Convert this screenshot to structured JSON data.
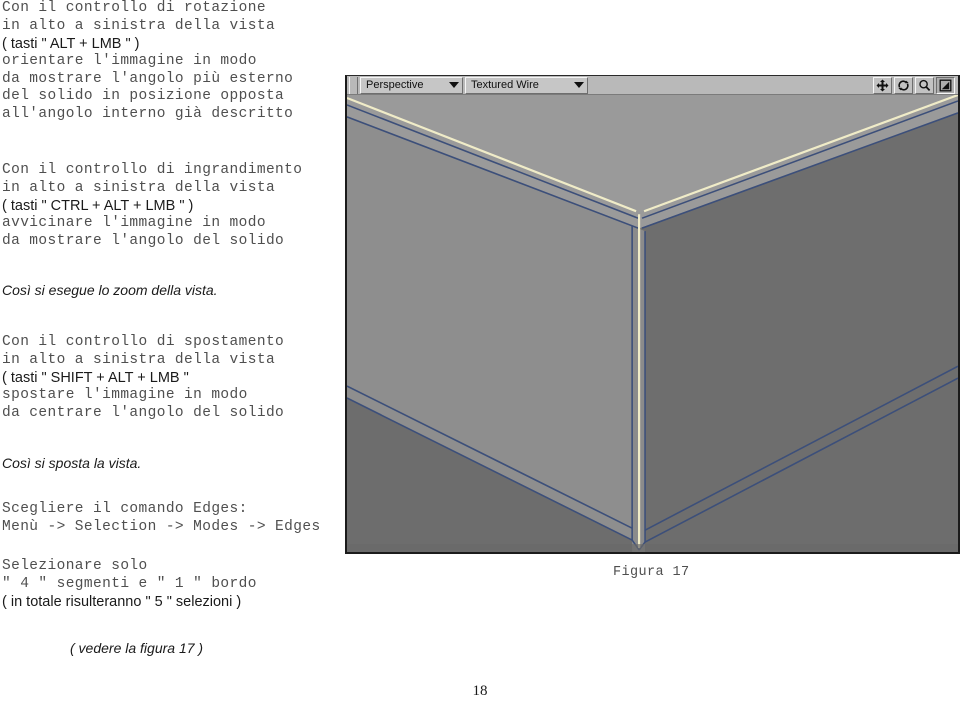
{
  "document": {
    "page_number": "18",
    "figure_caption": "Figura 17",
    "blocks": {
      "rotation": {
        "lines": [
          {
            "text": "Con il controllo di rotazione",
            "style": "mono"
          },
          {
            "text": "in alto a sinistra della vista",
            "style": "mono"
          },
          {
            "text": "( tasti \" ALT + LMB \" )",
            "style": "sans"
          },
          {
            "text": "orientare l'immagine in modo",
            "style": "mono"
          },
          {
            "text": "da mostrare l'angolo più esterno",
            "style": "mono"
          },
          {
            "text": "del solido in posizione opposta",
            "style": "mono"
          },
          {
            "text": "all'angolo interno già descritto",
            "style": "mono"
          }
        ]
      },
      "zoom": {
        "lines": [
          {
            "text": "Con il controllo di ingrandimento",
            "style": "mono"
          },
          {
            "text": "in alto a sinistra della vista",
            "style": "mono"
          },
          {
            "text": "( tasti \" CTRL + ALT + LMB \" )",
            "style": "sans"
          },
          {
            "text": "avvicinare l'immagine in modo",
            "style": "mono"
          },
          {
            "text": "da mostrare l'angolo del solido",
            "style": "mono"
          }
        ]
      },
      "zoom_note": {
        "lines": [
          {
            "text": "Così si esegue lo zoom della vista.",
            "style": "italic"
          }
        ]
      },
      "pan": {
        "lines": [
          {
            "text": "Con il controllo di spostamento",
            "style": "mono"
          },
          {
            "text": "in alto a sinistra della vista",
            "style": "mono"
          },
          {
            "text": "( tasti \" SHIFT + ALT + LMB \"",
            "style": "sans"
          },
          {
            "text": "spostare l'immagine in modo",
            "style": "mono"
          },
          {
            "text": "da centrare l'angolo del solido",
            "style": "mono"
          }
        ]
      },
      "pan_note": {
        "lines": [
          {
            "text": "Così si sposta la vista.",
            "style": "italic"
          }
        ]
      },
      "edges": {
        "lines": [
          {
            "text": "Scegliere il comando Edges:",
            "style": "mono"
          },
          {
            "text": "Menù -> Selection -> Modes -> Edges",
            "style": "mono"
          }
        ]
      },
      "selection": {
        "lines": [
          {
            "text": "Selezionare solo",
            "style": "mono"
          },
          {
            "text": "\" 4 \" segmenti e \" 1 \" bordo",
            "style": "mono"
          },
          {
            "text": "( in totale risulteranno \" 5 \" selezioni )",
            "style": "sans"
          }
        ]
      },
      "figure_ref": {
        "lines": [
          {
            "text": "( vedere la figura 17 )",
            "style": "italic"
          }
        ]
      }
    }
  },
  "viewport": {
    "view_label": "Perspective",
    "shading_label": "Textured Wire",
    "nav_buttons": [
      {
        "name": "pan-icon",
        "pressed": false
      },
      {
        "name": "orbit-icon",
        "pressed": false
      },
      {
        "name": "zoom-icon",
        "pressed": false
      },
      {
        "name": "maximize-viewport-icon",
        "pressed": true
      }
    ],
    "colors": {
      "background": "#6d6d6d",
      "top_face": "#9a9a9a",
      "left_face": "#8e8e8e",
      "right_face": "#6e6e6e",
      "inner_face": "#8b8b8b",
      "wire": "#3c4f7a",
      "selected_edge": "#f0ecc8",
      "toolbar": "#b9b9b9"
    }
  }
}
